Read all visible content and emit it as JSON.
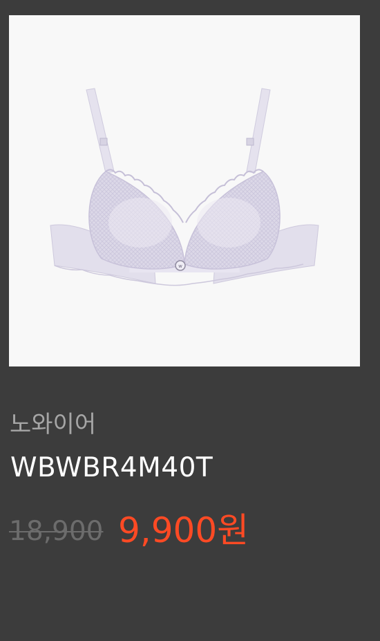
{
  "product": {
    "brand": "노와이어",
    "model": "WBWBR4M40T",
    "original_price": "18,900",
    "sale_price": "9,900원",
    "colors": {
      "background": "#3c3c3c",
      "image_background": "#f8f8f8",
      "brand_text": "#a6a6a6",
      "model_text": "#ffffff",
      "original_price_text": "#6c6c6c",
      "sale_price_text": "#ff4a24"
    }
  }
}
